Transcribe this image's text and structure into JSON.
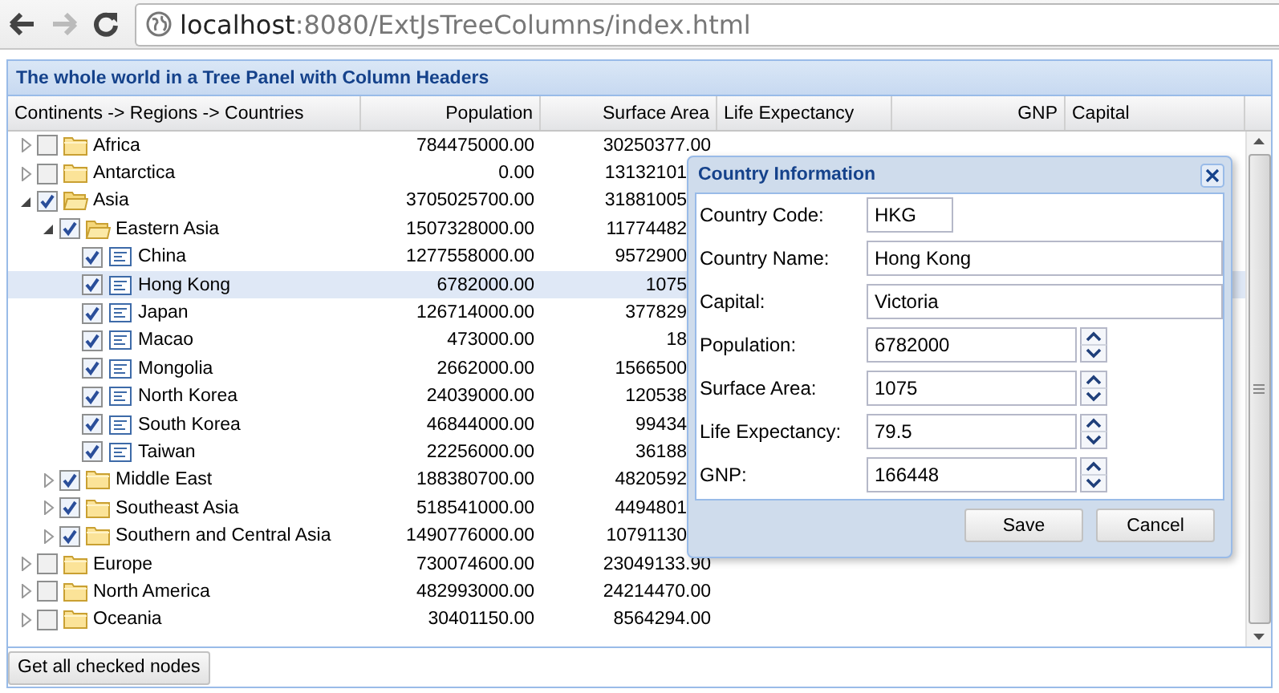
{
  "browser": {
    "url_host": "localhost",
    "url_path": ":8080/ExtJsTreeColumns/index.html"
  },
  "panel": {
    "title": "The whole world in a Tree Panel with Column Headers"
  },
  "tree": {
    "columns": [
      "Continents -> Regions -> Countries",
      "Population",
      "Surface Area",
      "Life Expectancy",
      "GNP",
      "Capital"
    ],
    "nodes": [
      {
        "kind": "folder",
        "name": "Africa",
        "population": "784475000.00",
        "surface_area": "30250377.00",
        "checked": false,
        "expanded": false,
        "selected": false
      },
      {
        "kind": "folder",
        "name": "Antarctica",
        "population": "0.00",
        "surface_area": "13132101",
        "checked": false,
        "expanded": false,
        "selected": false
      },
      {
        "kind": "folder",
        "name": "Asia",
        "population": "3705025700.00",
        "surface_area": "31881005",
        "checked": true,
        "expanded": true,
        "selected": false,
        "children": [
          {
            "kind": "folder",
            "name": "Eastern Asia",
            "population": "1507328000.00",
            "surface_area": "11774482",
            "checked": true,
            "expanded": true,
            "selected": false,
            "children": [
              {
                "kind": "leaf",
                "name": "China",
                "population": "1277558000.00",
                "surface_area": "9572900",
                "checked": true,
                "selected": false
              },
              {
                "kind": "leaf",
                "name": "Hong Kong",
                "population": "6782000.00",
                "surface_area": "1075",
                "checked": true,
                "selected": true
              },
              {
                "kind": "leaf",
                "name": "Japan",
                "population": "126714000.00",
                "surface_area": "377829",
                "checked": true,
                "selected": false
              },
              {
                "kind": "leaf",
                "name": "Macao",
                "population": "473000.00",
                "surface_area": "18",
                "checked": true,
                "selected": false
              },
              {
                "kind": "leaf",
                "name": "Mongolia",
                "population": "2662000.00",
                "surface_area": "1566500",
                "checked": true,
                "selected": false
              },
              {
                "kind": "leaf",
                "name": "North Korea",
                "population": "24039000.00",
                "surface_area": "120538",
                "checked": true,
                "selected": false
              },
              {
                "kind": "leaf",
                "name": "South Korea",
                "population": "46844000.00",
                "surface_area": "99434",
                "checked": true,
                "selected": false
              },
              {
                "kind": "leaf",
                "name": "Taiwan",
                "population": "22256000.00",
                "surface_area": "36188",
                "checked": true,
                "selected": false
              }
            ]
          },
          {
            "kind": "folder",
            "name": "Middle East",
            "population": "188380700.00",
            "surface_area": "4820592",
            "checked": true,
            "expanded": false,
            "selected": false
          },
          {
            "kind": "folder",
            "name": "Southeast Asia",
            "population": "518541000.00",
            "surface_area": "4494801",
            "checked": true,
            "expanded": false,
            "selected": false
          },
          {
            "kind": "folder",
            "name": "Southern and Central Asia",
            "population": "1490776000.00",
            "surface_area": "10791130",
            "checked": true,
            "expanded": false,
            "selected": false
          }
        ]
      },
      {
        "kind": "folder",
        "name": "Europe",
        "population": "730074600.00",
        "surface_area": "23049133.90",
        "checked": false,
        "expanded": false,
        "selected": false
      },
      {
        "kind": "folder",
        "name": "North America",
        "population": "482993000.00",
        "surface_area": "24214470.00",
        "checked": false,
        "expanded": false,
        "selected": false
      },
      {
        "kind": "folder",
        "name": "Oceania",
        "population": "30401150.00",
        "surface_area": "8564294.00",
        "checked": false,
        "expanded": false,
        "selected": false
      }
    ]
  },
  "dialog": {
    "title": "Country Information",
    "fields": [
      {
        "kind": "short",
        "label": "Country Code:",
        "value": "HKG"
      },
      {
        "kind": "text",
        "label": "Country Name:",
        "value": "Hong Kong"
      },
      {
        "kind": "text",
        "label": "Capital:",
        "value": "Victoria"
      },
      {
        "kind": "number",
        "label": "Population:",
        "value": "6782000"
      },
      {
        "kind": "number",
        "label": "Surface Area:",
        "value": "1075"
      },
      {
        "kind": "number",
        "label": "Life Expectancy:",
        "value": "79.5"
      },
      {
        "kind": "number",
        "label": "GNP:",
        "value": "166448"
      }
    ],
    "buttons": [
      "Save",
      "Cancel"
    ]
  },
  "toolbar": {
    "button": "Get all checked nodes"
  }
}
